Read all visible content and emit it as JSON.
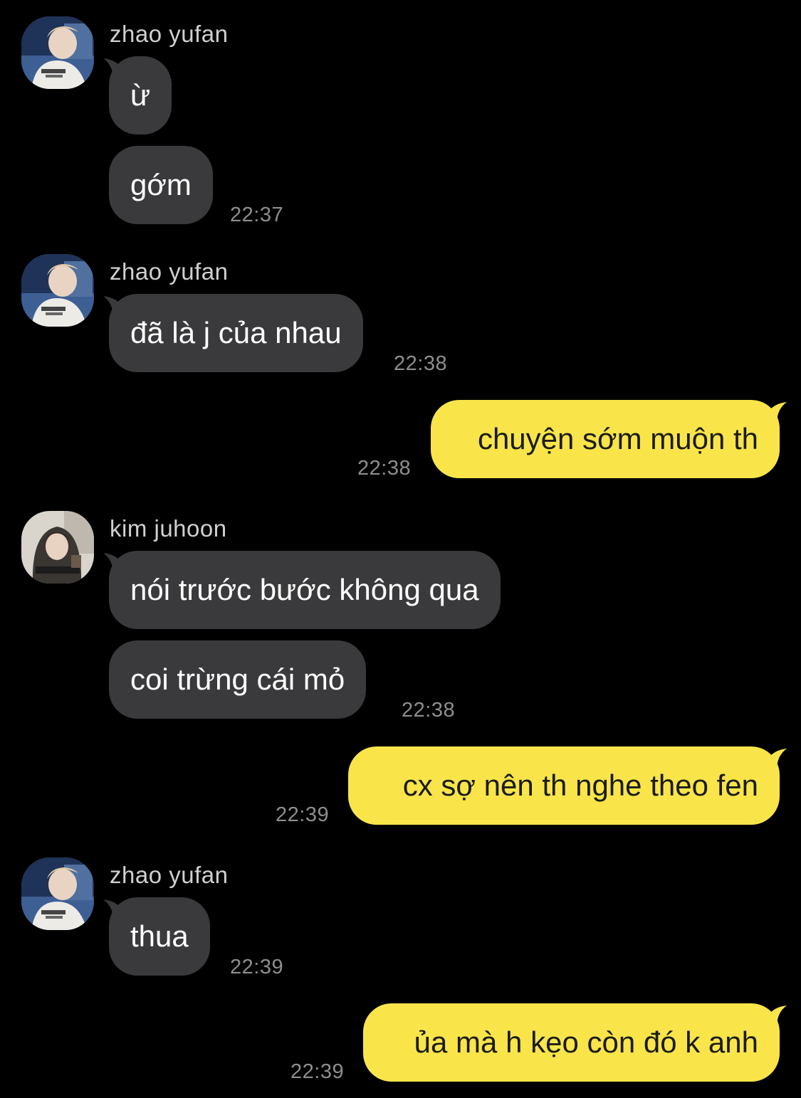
{
  "messages": [
    {
      "sender": "zhao yufan",
      "text": "ừ"
    },
    {
      "text": "gớm",
      "time": "22:37"
    },
    {
      "sender": "zhao yufan",
      "text": "đã là j của nhau",
      "time": "22:38"
    },
    {
      "text": "chuyện sớm muộn th",
      "time": "22:38"
    },
    {
      "sender": "kim juhoon",
      "text": "nói trước bước không qua"
    },
    {
      "text": "coi trừng cái mỏ",
      "time": "22:38"
    },
    {
      "text": "cx sợ nên th nghe theo fen",
      "time": "22:39"
    },
    {
      "sender": "zhao yufan",
      "text": "thua",
      "time": "22:39"
    },
    {
      "text": "ủa mà h kẹo còn đó k anh",
      "time": "22:39"
    }
  ],
  "colors": {
    "background": "#000000",
    "incoming_bubble": "#3a3a3c",
    "outgoing_bubble": "#f9e54a",
    "timestamp": "#8e8e8e",
    "sender_name": "#d0d0d0"
  },
  "icons": {
    "zhao_yufan_avatar": "profile-photo-zhao-yufan",
    "kim_juhoon_avatar": "profile-photo-kim-juhoon"
  }
}
